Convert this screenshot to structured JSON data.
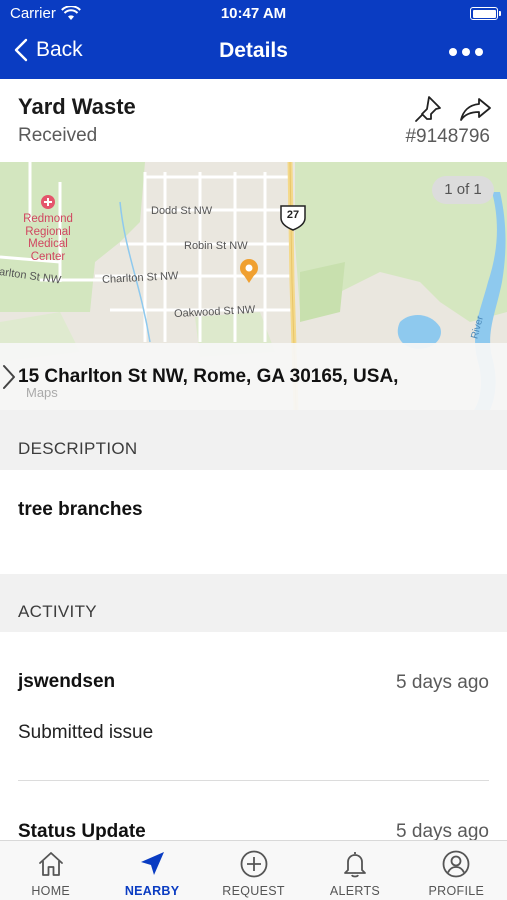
{
  "status_bar": {
    "carrier": "Carrier",
    "time": "10:47 AM"
  },
  "nav": {
    "back_label": "Back",
    "title": "Details"
  },
  "issue": {
    "title": "Yard Waste",
    "status": "Received",
    "id": "#9148796"
  },
  "map": {
    "counter": "1 of 1",
    "address": "15 Charlton St NW, Rome, GA 30165, USA,",
    "attribution": "Maps",
    "labels": {
      "dodd": "Dodd St NW",
      "robin": "Robin St NW",
      "charlton_left": "arlton St NW",
      "charlton": "Charlton St NW",
      "oakwood": "Oakwood St NW",
      "hospital_1": "Redmond",
      "hospital_2": "Regional",
      "hospital_3": "Medical",
      "hospital_4": "Center",
      "shield": "27",
      "river": "River"
    }
  },
  "description": {
    "header": "DESCRIPTION",
    "text": "tree branches"
  },
  "activity": {
    "header": "ACTIVITY",
    "items": [
      {
        "user": "jswendsen",
        "time": "5 days ago",
        "text": "Submitted issue"
      },
      {
        "user": "Status Update",
        "time": "5 days ago",
        "text": ""
      }
    ]
  },
  "tabs": [
    {
      "label": "HOME",
      "icon": "home-icon"
    },
    {
      "label": "NEARBY",
      "icon": "location-arrow-icon",
      "active": true
    },
    {
      "label": "REQUEST",
      "icon": "plus-circle-icon"
    },
    {
      "label": "ALERTS",
      "icon": "bell-icon"
    },
    {
      "label": "PROFILE",
      "icon": "user-circle-icon"
    }
  ],
  "colors": {
    "brand": "#0a3cc2",
    "pin": "#f0a030",
    "water": "#8ec9ee",
    "park": "#cfe3b5"
  }
}
